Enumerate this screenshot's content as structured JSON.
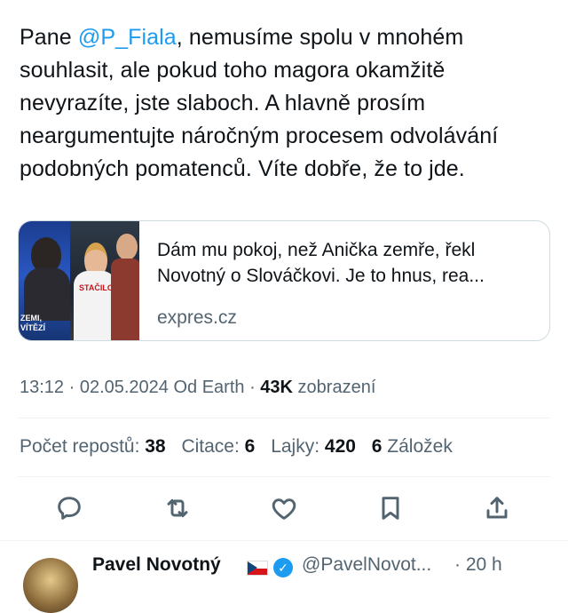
{
  "tweet": {
    "text_prefix": "Pane ",
    "mention": "@P_Fiala",
    "text_rest": ", nemusíme spolu v mnohém souhlasit, ale pokud toho magora okamžitě nevyrazíte, jste slaboch. A hlavně prosím neargumentujte náročným procesem odvolávání podobných pomatenců. Víte dobře, že to jde."
  },
  "link_card": {
    "thumb_caption_left": "ZEMI,\nVÍTĚZÍ",
    "thumb_caption_shirt": "STAČILO",
    "title": "Dám mu pokoj, než Anička zemře, řekl Novotný o Slováčkovi. Je to hnus, rea...",
    "domain": "expres.cz"
  },
  "meta": {
    "timestamp": "13:12 · 02.05.2024",
    "source": " Od Earth · ",
    "views_count": "43K",
    "views_label": " zobrazení"
  },
  "stats": {
    "reposts_label": "Počet repostů: ",
    "reposts_count": "38",
    "quotes_label": "Citace: ",
    "quotes_count": "6",
    "likes_label": "Lajky: ",
    "likes_count": "420",
    "bookmarks_count": "6",
    "bookmarks_label": " Záložek"
  },
  "actions": [
    {
      "name": "reply",
      "icon": "reply-icon"
    },
    {
      "name": "repost",
      "icon": "repost-icon"
    },
    {
      "name": "like",
      "icon": "heart-icon"
    },
    {
      "name": "bookmark",
      "icon": "bookmark-icon"
    },
    {
      "name": "share",
      "icon": "share-icon"
    }
  ],
  "next_tweet": {
    "name": "Pavel Novotný",
    "handle": "@PavelNovot...",
    "time": "· 20 h"
  },
  "colors": {
    "accent": "#1d9bf0",
    "text": "#0f1419",
    "secondary": "#536471",
    "border": "#cfd9de"
  }
}
